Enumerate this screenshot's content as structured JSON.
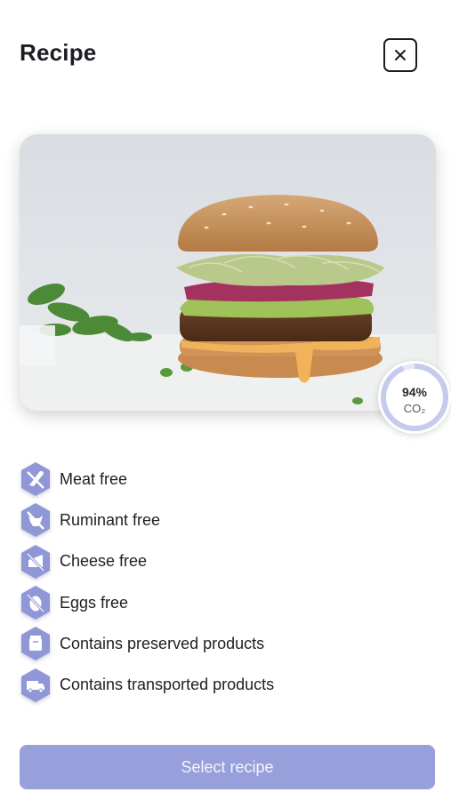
{
  "header": {
    "title": "Recipe"
  },
  "hero": {
    "alt": "Veggie burger"
  },
  "co2": {
    "percent_text": "94%",
    "label": "CO₂",
    "fraction": 0.94
  },
  "attributes": [
    {
      "label": "Meat free",
      "icon": "no-meat-icon"
    },
    {
      "label": "Ruminant free",
      "icon": "no-ruminant-icon"
    },
    {
      "label": "Cheese free",
      "icon": "no-cheese-icon"
    },
    {
      "label": "Eggs free",
      "icon": "no-egg-icon"
    },
    {
      "label": "Contains preserved products",
      "icon": "preserved-icon"
    },
    {
      "label": "Contains transported products",
      "icon": "truck-icon"
    }
  ],
  "actions": {
    "select_label": "Select recipe"
  },
  "colors": {
    "accent": "#98a0dc",
    "hex_icon": "#8f97d6",
    "ring": "#c7cbeb"
  }
}
